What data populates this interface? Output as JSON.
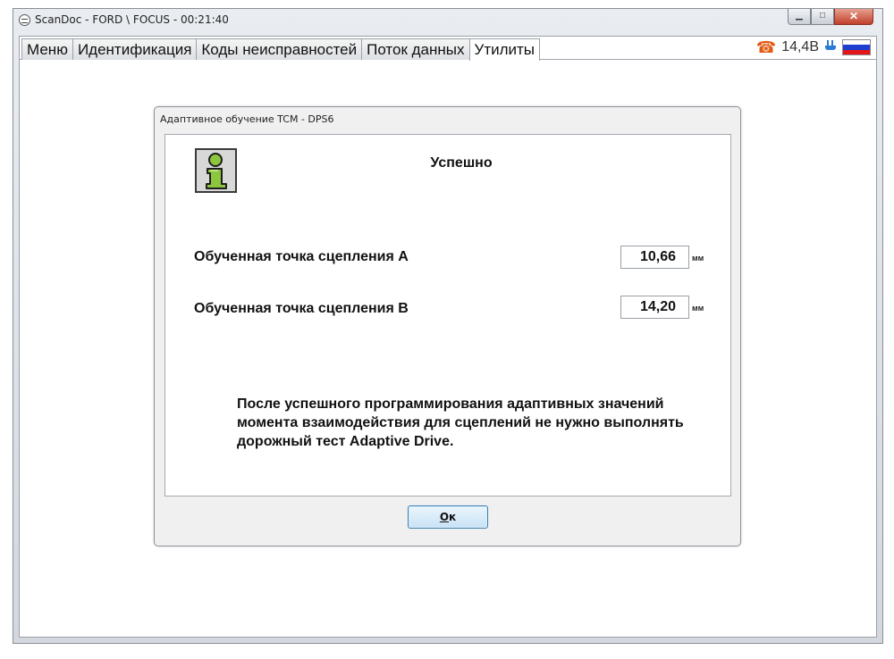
{
  "window": {
    "title": "ScanDoc - FORD \\ FOCUS - 00:21:40",
    "min_glyph": "▁",
    "max_glyph": "□",
    "close_glyph": "✕"
  },
  "tabs": [
    {
      "label": "Меню",
      "active": false
    },
    {
      "label": "Идентификация",
      "active": false
    },
    {
      "label": "Коды неисправностей",
      "active": false
    },
    {
      "label": "Поток данных",
      "active": false
    },
    {
      "label": "Утилиты",
      "active": true
    }
  ],
  "status": {
    "phone_icon": "☎",
    "voltage": "14,4В",
    "plug_icon": "plug-icon",
    "flag_colors": [
      "#ffffff",
      "#1c3fd1",
      "#e3141a"
    ]
  },
  "dialog": {
    "title": "Адаптивное обучение TCM - DPS6",
    "heading": "Успешно",
    "fields": [
      {
        "label": "Обученная точка сцепления А",
        "value": "10,66",
        "unit": "мм"
      },
      {
        "label": "Обученная точка сцепления В",
        "value": "14,20",
        "unit": "мм"
      }
    ],
    "note": "После успешного программирования адаптивных значений момента взаимодействия для сцеплений не нужно выполнять дорожный тест Adaptive Drive.",
    "ok_label": "Ок"
  }
}
